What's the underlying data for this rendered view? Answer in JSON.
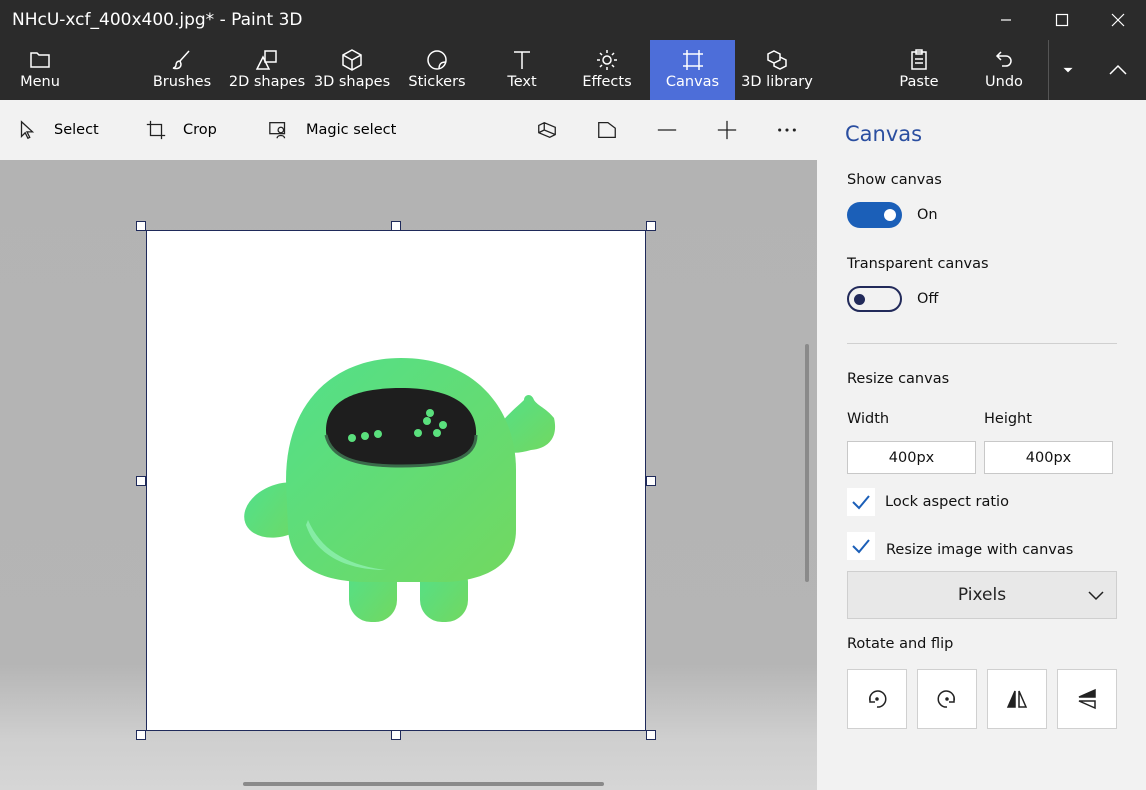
{
  "window": {
    "title": "NHcU-xcf_400x400.jpg* - Paint 3D"
  },
  "ribbon": {
    "menu": "Menu",
    "brushes": "Brushes",
    "shapes2d": "2D shapes",
    "shapes3d": "3D shapes",
    "stickers": "Stickers",
    "text": "Text",
    "effects": "Effects",
    "canvas": "Canvas",
    "library3d": "3D library",
    "paste": "Paste",
    "undo": "Undo",
    "active": "canvas"
  },
  "toolbar": {
    "select": "Select",
    "crop": "Crop",
    "magic_select": "Magic select"
  },
  "panel": {
    "title": "Canvas",
    "show_canvas": {
      "label": "Show canvas",
      "state": "On"
    },
    "transparent_canvas": {
      "label": "Transparent canvas",
      "state": "Off"
    },
    "resize_canvas": "Resize canvas",
    "width_label": "Width",
    "height_label": "Height",
    "width_value": "400px",
    "height_value": "400px",
    "lock_aspect_ratio": "Lock aspect ratio",
    "resize_image_with_canvas": "Resize image with canvas",
    "units": "Pixels",
    "rotate_and_flip": "Rotate and flip"
  },
  "colors": {
    "accent": "#4d6ed9",
    "toggle_on": "#1b5fb8",
    "titlebar": "#2b2b2b",
    "panel_title": "#2a4ea0"
  }
}
